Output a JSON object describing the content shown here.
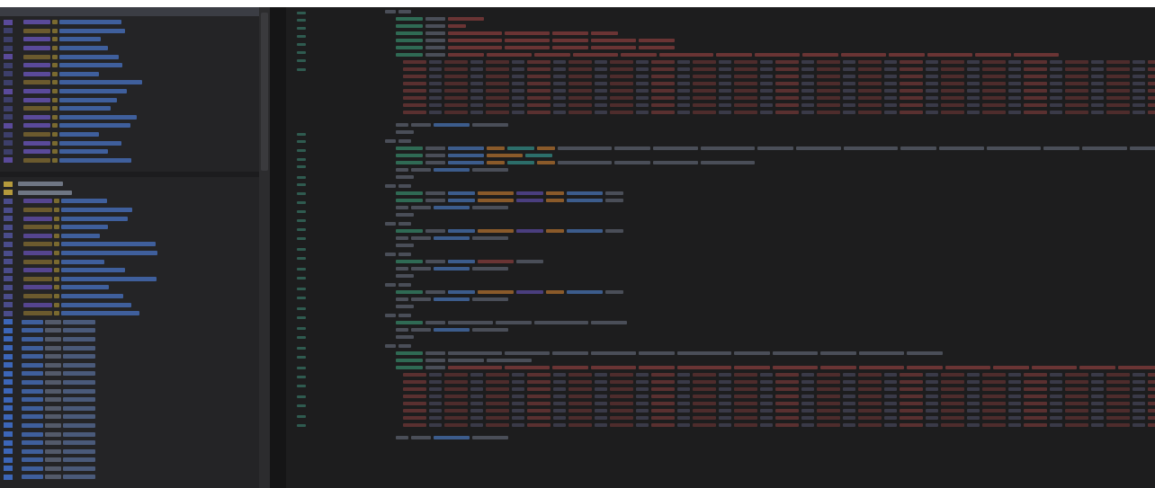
{
  "colors": {
    "background": "#1d1d1e",
    "sidebar": "#242426",
    "keyword_purple": "#8a6ad8",
    "string_orange": "#c98a3a",
    "identifier_blue": "#4f79c6",
    "comment_green": "#3e7e62",
    "hex_red": "#8c4040",
    "teal": "#3a8f8a",
    "muted": "#6f7684"
  },
  "sidebar": {
    "top_section_label": "",
    "bottom_section_label": ""
  },
  "editor": {
    "language": "",
    "status": ""
  }
}
